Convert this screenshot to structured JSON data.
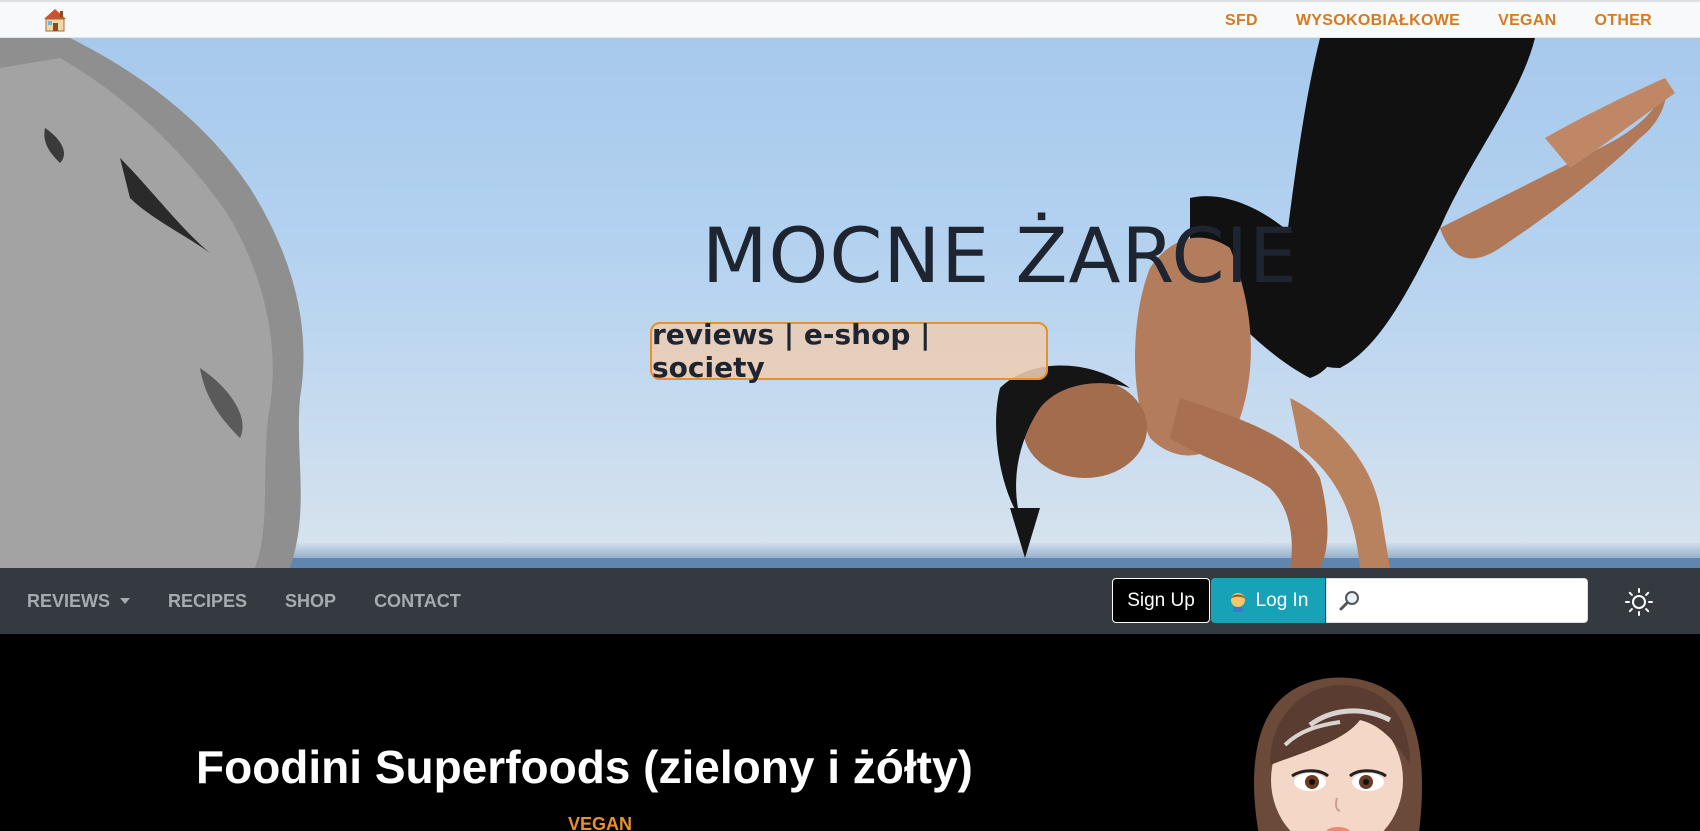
{
  "topbar": {
    "home_icon": "house-icon",
    "links": [
      "SFD",
      "WYSOKOBIAŁKOWE",
      "VEGAN",
      "OTHER"
    ],
    "link_color": "#d67a1f"
  },
  "hero": {
    "title": "MOCNE ŻARCIE",
    "tagline": "reviews | e-shop | society",
    "tagline_border": "#e8902e"
  },
  "navbar": {
    "links": [
      "REVIEWS",
      "RECIPES",
      "SHOP",
      "CONTACT"
    ],
    "signup_label": "Sign Up",
    "login_label": "Log In",
    "search_placeholder": "",
    "search_icon": "magnifier-icon",
    "theme_icon": "sun-icon",
    "login_color": "#17a2b8"
  },
  "article": {
    "title": "Foodini Superfoods (zielony i żółty)",
    "category": "VEGAN",
    "category_color": "#e8902e"
  }
}
